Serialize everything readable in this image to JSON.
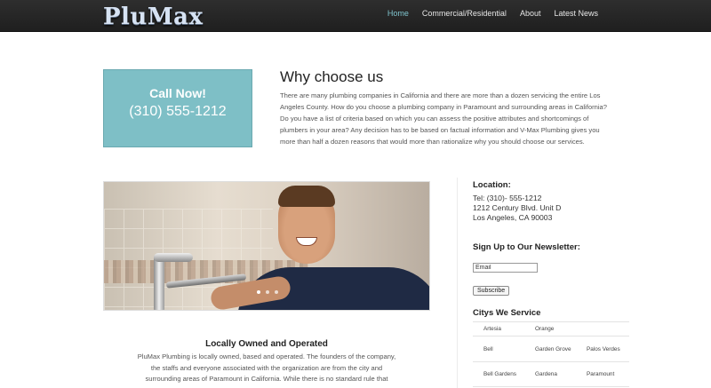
{
  "header": {
    "logo": "PluMax",
    "nav": [
      "Home",
      "Commercial/Residential",
      "About",
      "Latest News"
    ],
    "active_nav": "Home"
  },
  "callout": {
    "title": "Call Now!",
    "phone": "(310) 555-1212",
    "background_color": "#7ebfc6"
  },
  "why": {
    "heading": "Why choose us",
    "body": "There are many plumbing companies in California and there are more than a dozen servicing the entire Los Angeles County. How do you choose a plumbing company in Paramount and surrounding areas in California? Do you have a list of criteria based on which you can assess the positive attributes and shortcomings of plumbers in your area? Any decision has to be based on factual information and V-Max Plumbing gives you more than half a dozen reasons that would more than rationalize why you should choose our services."
  },
  "hero": {
    "image_description_icon": "smiling-plumber-photo",
    "slide_count": 3,
    "active_slide": 1
  },
  "local": {
    "heading": "Locally Owned and Operated",
    "body": "PluMax Plumbing is locally owned, based and operated. The founders of the company, the staffs and everyone associated with the organization are from the city and surrounding areas of Paramount in California. While there is no standard rule that"
  },
  "sidebar": {
    "location": {
      "heading": "Location:",
      "phone": "Tel: (310)- 555-1212",
      "address1": "1212 Century Blvd. Unit D",
      "address2": "Los Angeles, CA 90003"
    },
    "newsletter": {
      "heading": "Sign Up to Our Newsletter:",
      "email_value": "Email",
      "subscribe_label": "Subscribe"
    },
    "cities": {
      "heading": "Citys We Service",
      "rows": [
        [
          "Artesia",
          "Orange",
          ""
        ],
        [
          "Bell",
          "Garden Grove",
          "Palos Verdes"
        ],
        [
          "Bell Gardens",
          "Gardena",
          "Paramount"
        ]
      ]
    }
  },
  "colors": {
    "nav_active": "#7fc4ce",
    "topbar": "#262626"
  }
}
